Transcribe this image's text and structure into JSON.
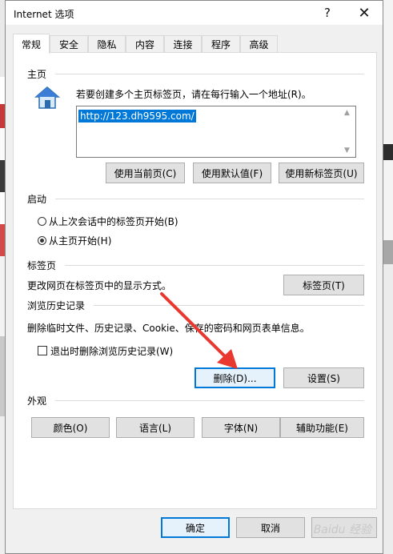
{
  "window": {
    "title": "Internet 选项",
    "help_glyph": "?",
    "close_glyph": "✕"
  },
  "tabs": [
    {
      "label": "常规",
      "active": true
    },
    {
      "label": "安全"
    },
    {
      "label": "隐私"
    },
    {
      "label": "内容"
    },
    {
      "label": "连接"
    },
    {
      "label": "程序"
    },
    {
      "label": "高级"
    }
  ],
  "home": {
    "section_label": "主页",
    "instructions": "若要创建多个主页标签页，请在每行输入一个地址(R)。",
    "url": "http://123.dh9595.com/",
    "buttons": [
      "使用当前页(C)",
      "使用默认值(F)",
      "使用新标签页(U)"
    ]
  },
  "startup": {
    "section_label": "启动",
    "options": [
      {
        "label": "从上次会话中的标签页开始(B)",
        "selected": false
      },
      {
        "label": "从主页开始(H)",
        "selected": true
      }
    ]
  },
  "tabs_section": {
    "section_label": "标签页",
    "description": "更改网页在标签页中的显示方式。",
    "button": "标签页(T)"
  },
  "history": {
    "section_label": "浏览历史记录",
    "description": "删除临时文件、历史记录、Cookie、保存的密码和网页表单信息。",
    "checkbox_label": "退出时删除浏览历史记录(W)",
    "checkbox_checked": false,
    "delete_button": "删除(D)...",
    "settings_button": "设置(S)"
  },
  "appearance": {
    "section_label": "外观",
    "buttons": [
      "颜色(O)",
      "语言(L)",
      "字体(N)",
      "辅助功能(E)"
    ]
  },
  "footer": {
    "ok": "确定",
    "cancel": "取消"
  },
  "watermark": "Baidu 经验",
  "colors": {
    "accent": "#0078d7",
    "arrow": "#e8382f"
  }
}
